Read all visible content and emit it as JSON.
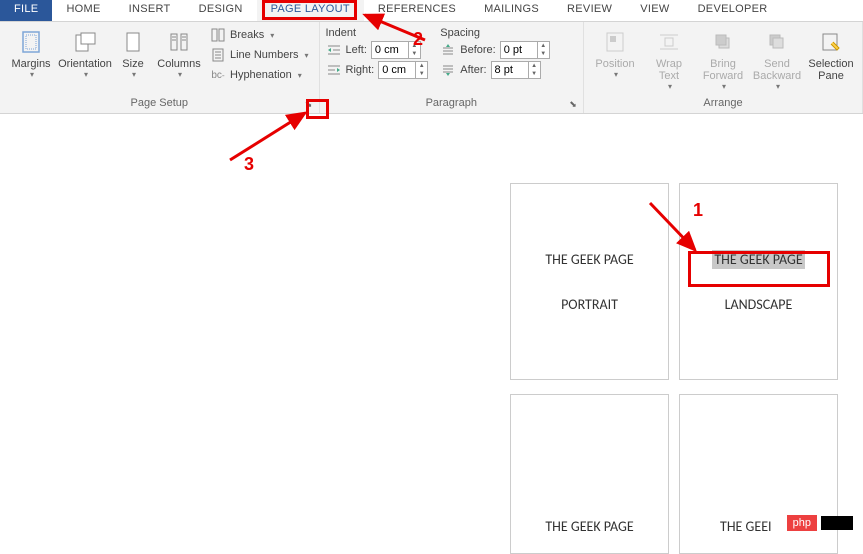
{
  "tabs": {
    "file": "FILE",
    "home": "HOME",
    "insert": "INSERT",
    "design": "DESIGN",
    "pagelayout": "PAGE LAYOUT",
    "references": "REFERENCES",
    "mailings": "MAILINGS",
    "review": "REVIEW",
    "view": "VIEW",
    "developer": "DEVELOPER"
  },
  "pagesetup": {
    "group_label": "Page Setup",
    "margins": "Margins",
    "orientation": "Orientation",
    "size": "Size",
    "columns": "Columns",
    "breaks": "Breaks",
    "linenumbers": "Line Numbers",
    "hyphenation": "Hyphenation"
  },
  "paragraph": {
    "group_label": "Paragraph",
    "indent_label": "Indent",
    "spacing_label": "Spacing",
    "left_label": "Left:",
    "right_label": "Right:",
    "before_label": "Before:",
    "after_label": "After:",
    "left_value": "0 cm",
    "right_value": "0 cm",
    "before_value": "0 pt",
    "after_value": "8 pt"
  },
  "arrange": {
    "group_label": "Arrange",
    "position": "Position",
    "wraptext": "Wrap Text",
    "bringforward": "Bring Forward",
    "sendbackward": "Send Backward",
    "selectionpane": "Selection Pane"
  },
  "doc": {
    "p1_head": "THE GEEK PAGE",
    "p1_sub": "PORTRAIT",
    "p2_head": "THE GEEK PAGE",
    "p2_sub": "LANDSCAPE",
    "p3_head": "THE GEEK PAGE",
    "p4_head": "THE GEEI"
  },
  "annotations": {
    "n1": "1",
    "n2": "2",
    "n3": "3"
  },
  "watermark": "php"
}
